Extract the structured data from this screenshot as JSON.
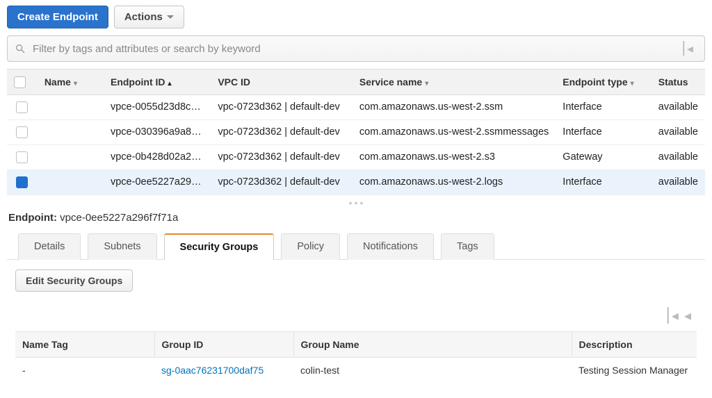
{
  "toolbar": {
    "create_label": "Create Endpoint",
    "actions_label": "Actions"
  },
  "search": {
    "placeholder": "Filter by tags and attributes or search by keyword"
  },
  "columns": {
    "name": "Name",
    "endpoint_id": "Endpoint ID",
    "vpc_id": "VPC ID",
    "service_name": "Service name",
    "endpoint_type": "Endpoint type",
    "status": "Status"
  },
  "rows": [
    {
      "selected": false,
      "name": "",
      "endpoint_id": "vpce-0055d23d8c…",
      "vpc_id": "vpc-0723d362 | default-dev",
      "service_name": "com.amazonaws.us-west-2.ssm",
      "endpoint_type": "Interface",
      "status": "available"
    },
    {
      "selected": false,
      "name": "",
      "endpoint_id": "vpce-030396a9a8…",
      "vpc_id": "vpc-0723d362 | default-dev",
      "service_name": "com.amazonaws.us-west-2.ssmmessages",
      "endpoint_type": "Interface",
      "status": "available"
    },
    {
      "selected": false,
      "name": "",
      "endpoint_id": "vpce-0b428d02a2…",
      "vpc_id": "vpc-0723d362 | default-dev",
      "service_name": "com.amazonaws.us-west-2.s3",
      "endpoint_type": "Gateway",
      "status": "available"
    },
    {
      "selected": true,
      "name": "",
      "endpoint_id": "vpce-0ee5227a29…",
      "vpc_id": "vpc-0723d362 | default-dev",
      "service_name": "com.amazonaws.us-west-2.logs",
      "endpoint_type": "Interface",
      "status": "available"
    }
  ],
  "detail": {
    "label": "Endpoint:",
    "value": "vpce-0ee5227a296f7f71a"
  },
  "tabs": {
    "details": "Details",
    "subnets": "Subnets",
    "security_groups": "Security Groups",
    "policy": "Policy",
    "notifications": "Notifications",
    "tags": "Tags",
    "active": "security_groups"
  },
  "sg_panel": {
    "edit_button": "Edit Security Groups",
    "columns": {
      "name_tag": "Name Tag",
      "group_id": "Group ID",
      "group_name": "Group Name",
      "description": "Description"
    },
    "rows": [
      {
        "name_tag": "-",
        "group_id": "sg-0aac76231700daf75",
        "group_name": "colin-test",
        "description": "Testing Session Manager"
      }
    ]
  }
}
